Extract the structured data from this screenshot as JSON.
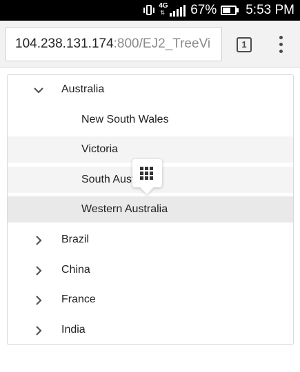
{
  "status_bar": {
    "network": "4G",
    "battery_percent": "67%",
    "battery_level": 0.67,
    "time": "5:53 PM",
    "icons": [
      "vibrate-icon",
      "signal-icon",
      "battery-icon"
    ]
  },
  "browser": {
    "url_host": "104.238.131.174",
    "url_path": ":800/EJ2_TreeVi",
    "tab_count": "1",
    "menu_icon": "overflow-menu-icon"
  },
  "tree": {
    "nodes": [
      {
        "label": "Australia",
        "level": 1,
        "expanded": true,
        "icon": "chevron-down-icon"
      },
      {
        "label": "New South Wales",
        "level": 2
      },
      {
        "label": "Victoria",
        "level": 2,
        "state": "hover"
      },
      {
        "label": "South Australia",
        "level": 2,
        "state": "hover"
      },
      {
        "label": "Western Australia",
        "level": 2,
        "state": "selected"
      },
      {
        "label": "Brazil",
        "level": 1,
        "expanded": false,
        "icon": "chevron-right-icon"
      },
      {
        "label": "China",
        "level": 1,
        "expanded": false,
        "icon": "chevron-right-icon"
      },
      {
        "label": "France",
        "level": 1,
        "expanded": false,
        "icon": "chevron-right-icon"
      },
      {
        "label": "India",
        "level": 1,
        "expanded": false,
        "icon": "chevron-right-icon"
      }
    ]
  },
  "popup": {
    "icon": "grid-menu-icon"
  },
  "colors": {
    "status_bar_bg": "#000000",
    "browser_bar_bg": "#f2f2f2",
    "hover_bg": "#f4f4f4",
    "selected_bg": "#e9e9e9",
    "text": "#212121",
    "url_path": "#8a8a8a"
  }
}
